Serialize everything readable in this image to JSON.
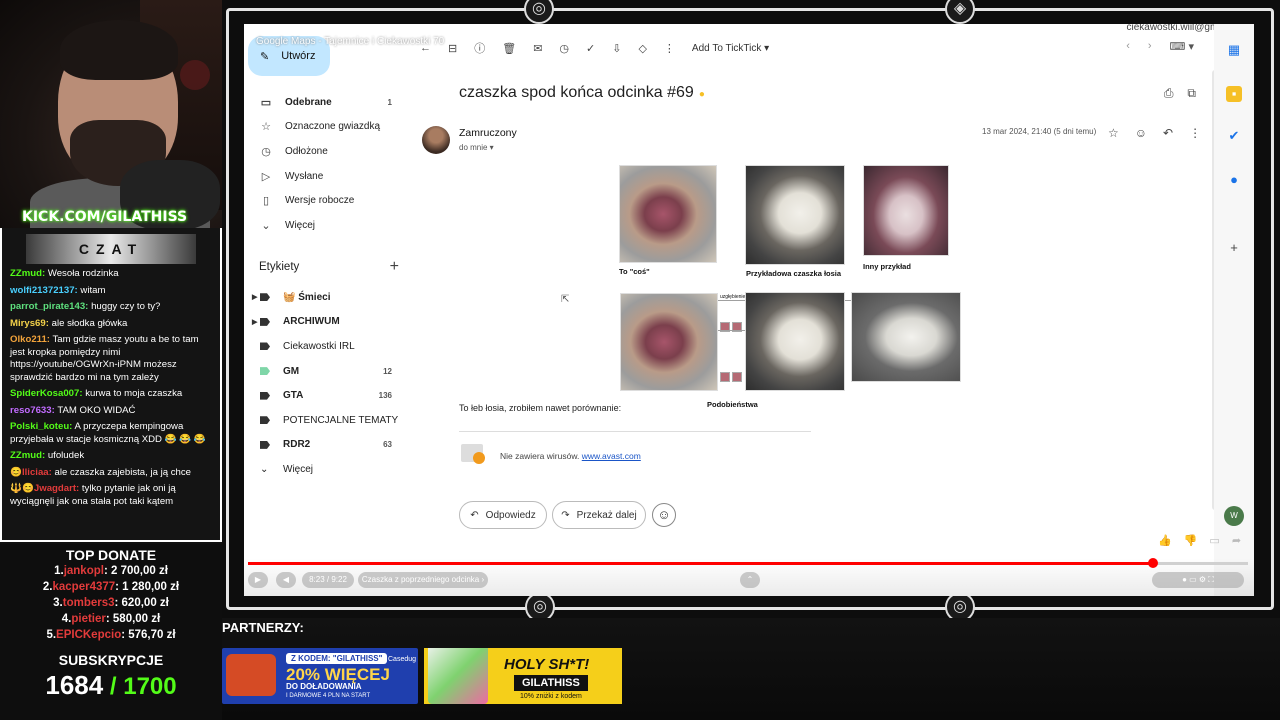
{
  "stream": {
    "kick_tag": "KICK.COM/GILATHISS",
    "chat_title": "CZAT",
    "chat": [
      {
        "user": "ZZmud:",
        "color": "#53fc18",
        "text": "Wesoła rodzinka"
      },
      {
        "user": "wolfi21372137:",
        "color": "#4ad0ff",
        "text": "witam"
      },
      {
        "user": "parrot_pirate143:",
        "color": "#5ee07e",
        "text": "huggy czy to ty?"
      },
      {
        "user": "Mirys69:",
        "color": "#f2d14a",
        "text": "ale słodka główka"
      },
      {
        "user": "Olko211:",
        "color": "#f2a33b",
        "text": "Tam gdzie masz youtu a be to tam jest kropka pomiędzy nimi https://youtube/OGWrXn-iPNM możesz sprawdzić bardzo mi na tym zależy"
      },
      {
        "user": "SpiderKosa007:",
        "color": "#53fc18",
        "text": "kurwa to moja czaszka"
      },
      {
        "user": "reso7633:",
        "color": "#c26cff",
        "text": "TAM OKO WIDAĆ"
      },
      {
        "user": "Polski_koteu:",
        "color": "#53fc18",
        "text": "A przyczepa kempingowa przyjebała w stacje kosmiczną XDD 😂 😂 😂"
      },
      {
        "user": "ZZmud:",
        "color": "#53fc18",
        "text": "ufoludek"
      },
      {
        "user": "😊lliciaa:",
        "color": "#e23b3b",
        "text": "ale czaszka zajebista, ja ją chce"
      },
      {
        "user": "🔱😊Jwagdart:",
        "color": "#e23b3b",
        "text": "tylko pytanie jak oni ją wyciągnęli jak ona stała pot taki kątem"
      }
    ],
    "top_donate_title": "TOP DONATE",
    "top_donate": [
      {
        "rank": "1.",
        "name": "jankopl",
        "amount": ": 2 700,00 zł"
      },
      {
        "rank": "2.",
        "name": "kacper4377",
        "amount": ": 1 280,00 zł"
      },
      {
        "rank": "3.",
        "name": "tombers3",
        "amount": ": 620,00 zł"
      },
      {
        "rank": "4.",
        "name": "pietier",
        "amount": ": 580,00 zł"
      },
      {
        "rank": "5.",
        "name": "EPICKepcio",
        "amount": ": 576,70 zł"
      }
    ],
    "subs_title": "SUBSKRYPCJE",
    "subs_current": "1684",
    "subs_goal": " / 1700",
    "partners_label": "PARTNERZY:",
    "banner1": {
      "code": "Z KODEM: \"GILATHISS\"",
      "big": "20% WIĘCEJ",
      "line1": "DO DOŁADOWANIA",
      "line2": "I DARMOWE 4 PLN NA START",
      "brand": "Casedug"
    },
    "banner2": {
      "big": "HOLY SH*T!",
      "code": "GILATHISS",
      "line": "10% zniżki z kodem"
    }
  },
  "video": {
    "title": "Google Maps - Tajemnice i Ciekawostki 70",
    "time": "8:23 / 9:22",
    "chapter": "Czaszka z poprzedniego odcinka ›",
    "progress_percent": 90.5
  },
  "gmail": {
    "account": "ciekawostki.wiil@gmail.com",
    "compose": "Utwórz",
    "nav": [
      {
        "label": "Odebrane",
        "count": "1",
        "icon": "inbox-icon",
        "glyph": "▭",
        "bold": true
      },
      {
        "label": "Oznaczone gwiazdką",
        "count": "",
        "icon": "star-icon",
        "glyph": "☆",
        "bold": false
      },
      {
        "label": "Odłożone",
        "count": "",
        "icon": "clock-icon",
        "glyph": "◷",
        "bold": false
      },
      {
        "label": "Wysłane",
        "count": "",
        "icon": "send-icon",
        "glyph": "▷",
        "bold": false
      },
      {
        "label": "Wersje robocze",
        "count": "",
        "icon": "draft-icon",
        "glyph": "▯",
        "bold": false
      },
      {
        "label": "Więcej",
        "count": "",
        "icon": "chevron-down-icon",
        "glyph": "⌄",
        "bold": false
      }
    ],
    "labels_title": "Etykiety",
    "labels": [
      {
        "label": "🧺 Śmieci",
        "count": "",
        "color": "#333",
        "arrow": true,
        "bold": true
      },
      {
        "label": "ARCHIWUM",
        "count": "",
        "color": "#333",
        "arrow": true,
        "bold": true
      },
      {
        "label": "Ciekawostki IRL",
        "count": "",
        "color": "#333",
        "arrow": false,
        "bold": false
      },
      {
        "label": "GM",
        "count": "12",
        "color": "#7fd6a8",
        "arrow": false,
        "bold": true
      },
      {
        "label": "GTA",
        "count": "136",
        "color": "#333",
        "arrow": false,
        "bold": true
      },
      {
        "label": "POTENCJALNE TEMATY",
        "count": "",
        "color": "#333",
        "arrow": false,
        "bold": false
      },
      {
        "label": "RDR2",
        "count": "63",
        "color": "#333",
        "arrow": false,
        "bold": true
      },
      {
        "label": "Więcej",
        "count": "",
        "color": "",
        "arrow": false,
        "bold": false
      }
    ],
    "toolbar_tick": "Add To TickTick ▾",
    "email": {
      "subject": "czaszka spod końca odcinka #69",
      "sender": "Zamruczony",
      "to": "do mnie ▾",
      "date": "13 mar 2024, 21:40 (5 dni temu)",
      "caption_1": "To \"coś\"",
      "caption_2": "Przykładowa czaszka łosia",
      "caption_3": "Inny przykład",
      "caption_compare": "Podobieństwa",
      "caption_small": "uzgłębienie",
      "body": "To łeb łosia, zrobiłem nawet porównanie:",
      "virus_text": "Nie zawiera wirusów.",
      "virus_link": "www.avast.com"
    },
    "reply": "Odpowiedz",
    "forward": "Przekaż dalej"
  }
}
